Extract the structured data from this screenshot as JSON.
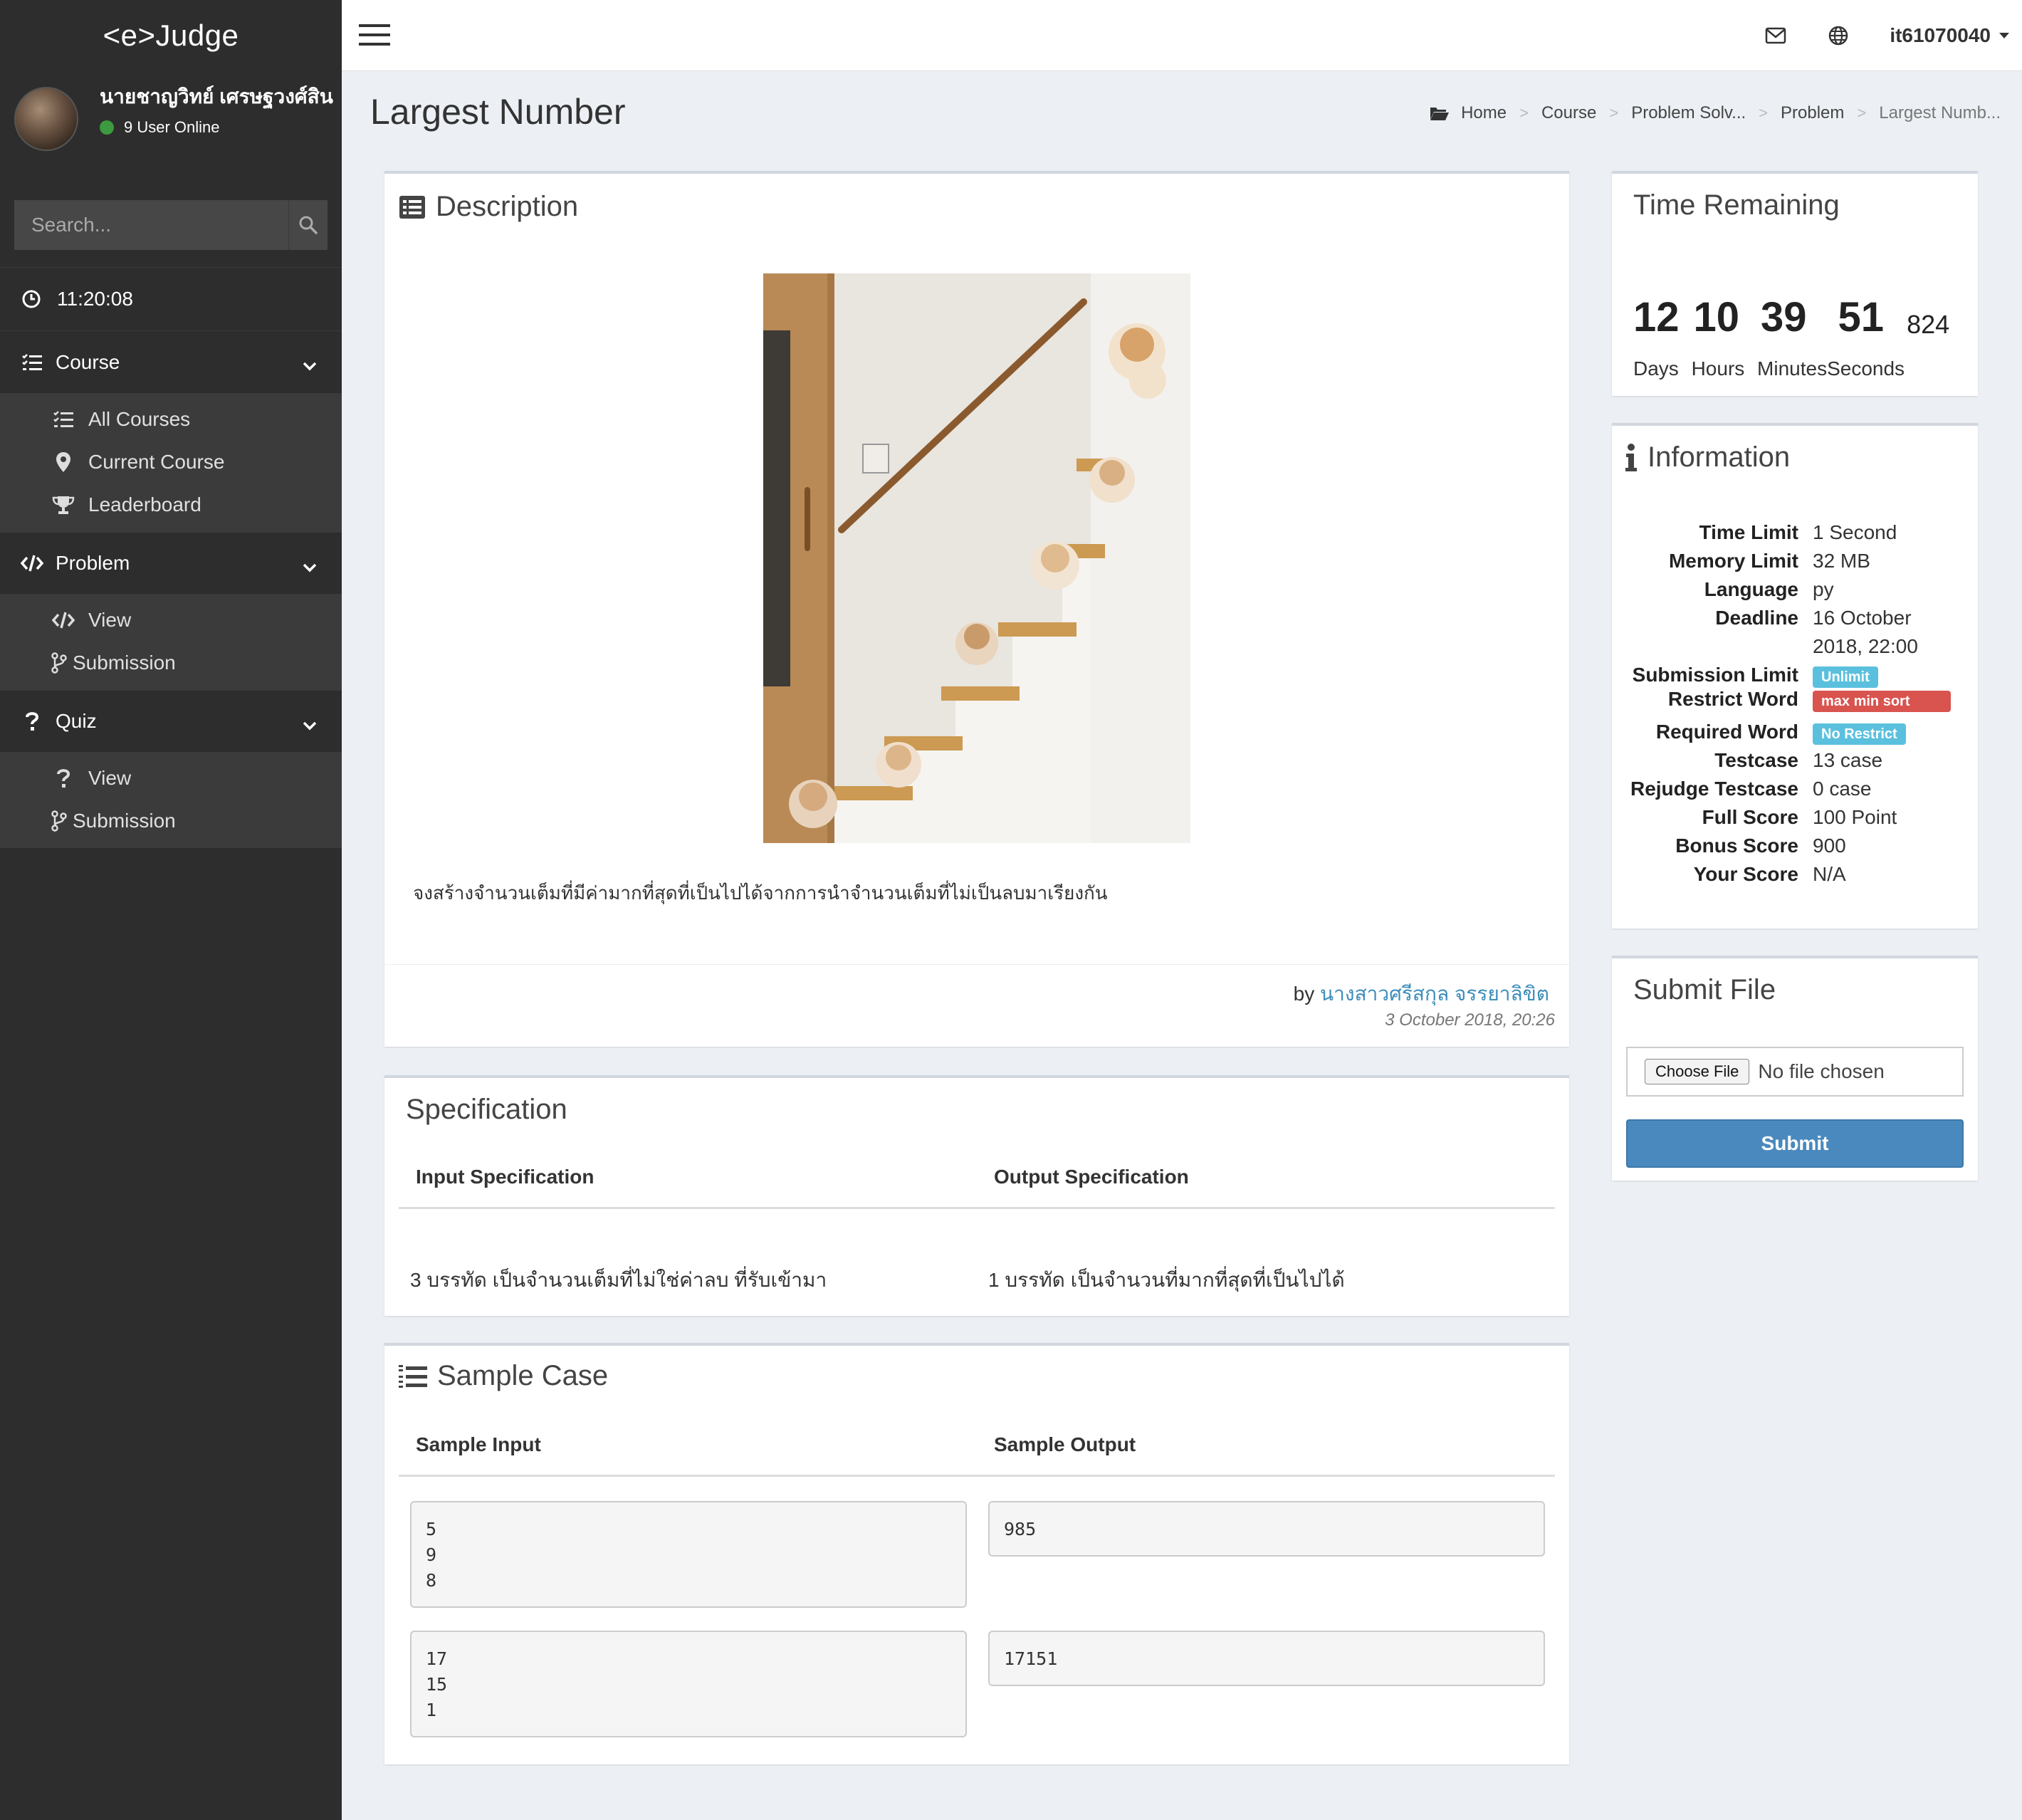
{
  "app": {
    "brand": "<e>Judge"
  },
  "user": {
    "name": "นายชาญวิทย์ เศรษฐวงศ์สิน",
    "online_text": "9 User Online",
    "username": "it61070040"
  },
  "search": {
    "placeholder": "Search..."
  },
  "clock": "11:20:08",
  "sidebar": {
    "course": {
      "label": "Course",
      "items": [
        {
          "label": "All Courses"
        },
        {
          "label": "Current Course"
        },
        {
          "label": "Leaderboard"
        }
      ]
    },
    "problem": {
      "label": "Problem",
      "items": [
        {
          "label": "View"
        },
        {
          "label": "Submission"
        }
      ]
    },
    "quiz": {
      "label": "Quiz",
      "items": [
        {
          "label": "View"
        },
        {
          "label": "Submission"
        }
      ]
    }
  },
  "page": {
    "title": "Largest Number"
  },
  "breadcrumb": [
    "Home",
    "Course",
    "Problem Solv...",
    "Problem",
    "Largest Numb..."
  ],
  "description": {
    "title": "Description",
    "text": "จงสร้างจำนวนเต็มที่มีค่ามากที่สุดที่เป็นไปได้จากการนำจำนวนเต็มที่ไม่เป็นลบมาเรียงกัน",
    "by_label": "by",
    "author": "นางสาวศรีสกุล จรรยาลิขิต",
    "posted": "3 October 2018, 20:26"
  },
  "specification": {
    "title": "Specification",
    "input_header": "Input Specification",
    "output_header": "Output Specification",
    "input_text": "3 บรรทัด เป็นจำนวนเต็มที่ไม่ใช่ค่าลบ ที่รับเข้ามา",
    "output_text": "1 บรรทัด เป็นจำนวนที่มากที่สุดที่เป็นไปได้"
  },
  "sample": {
    "title": "Sample Case",
    "input_header": "Sample Input",
    "output_header": "Sample Output",
    "cases": [
      {
        "input": "5\n9\n8",
        "output": "985"
      },
      {
        "input": "17\n15\n1",
        "output": "17151"
      }
    ]
  },
  "time_remaining": {
    "title": "Time Remaining",
    "days": "12",
    "hours": "10",
    "minutes": "39",
    "seconds": "51",
    "ms": "824",
    "labels": "Days Hours MinutesSeconds"
  },
  "information": {
    "title": "Information",
    "time_limit": {
      "key": "Time Limit",
      "value": "1 Second"
    },
    "memory_limit": {
      "key": "Memory Limit",
      "value": "32 MB"
    },
    "language": {
      "key": "Language",
      "value": "py"
    },
    "deadline": {
      "key": "Deadline",
      "value": "16 October 2018, 22:00"
    },
    "submission_limit": {
      "key": "Submission Limit",
      "value": "Unlimit"
    },
    "restrict_word": {
      "key": "Restrict Word",
      "value": "max min sort"
    },
    "required_word": {
      "key": "Required Word",
      "value": "No Restrict"
    },
    "testcase": {
      "key": "Testcase",
      "value": "13 case"
    },
    "rejudge_testcase": {
      "key": "Rejudge Testcase",
      "value": "0 case"
    },
    "full_score": {
      "key": "Full Score",
      "value": "100 Point"
    },
    "bonus_score": {
      "key": "Bonus Score",
      "value": "900"
    },
    "your_score": {
      "key": "Your Score",
      "value": "N/A"
    }
  },
  "submit_file": {
    "title": "Submit File",
    "choose_label": "Choose File",
    "no_file": "No file chosen",
    "submit_label": "Submit"
  },
  "colors": {
    "sidebar_bg": "#2d2d2d",
    "submenu_bg": "#3b3b3b",
    "accent": "#3c8dbc",
    "submit_btn": "#4a89bd",
    "badge_info": "#5bc0de",
    "badge_danger": "#d9534f",
    "online": "#3c9a40"
  }
}
